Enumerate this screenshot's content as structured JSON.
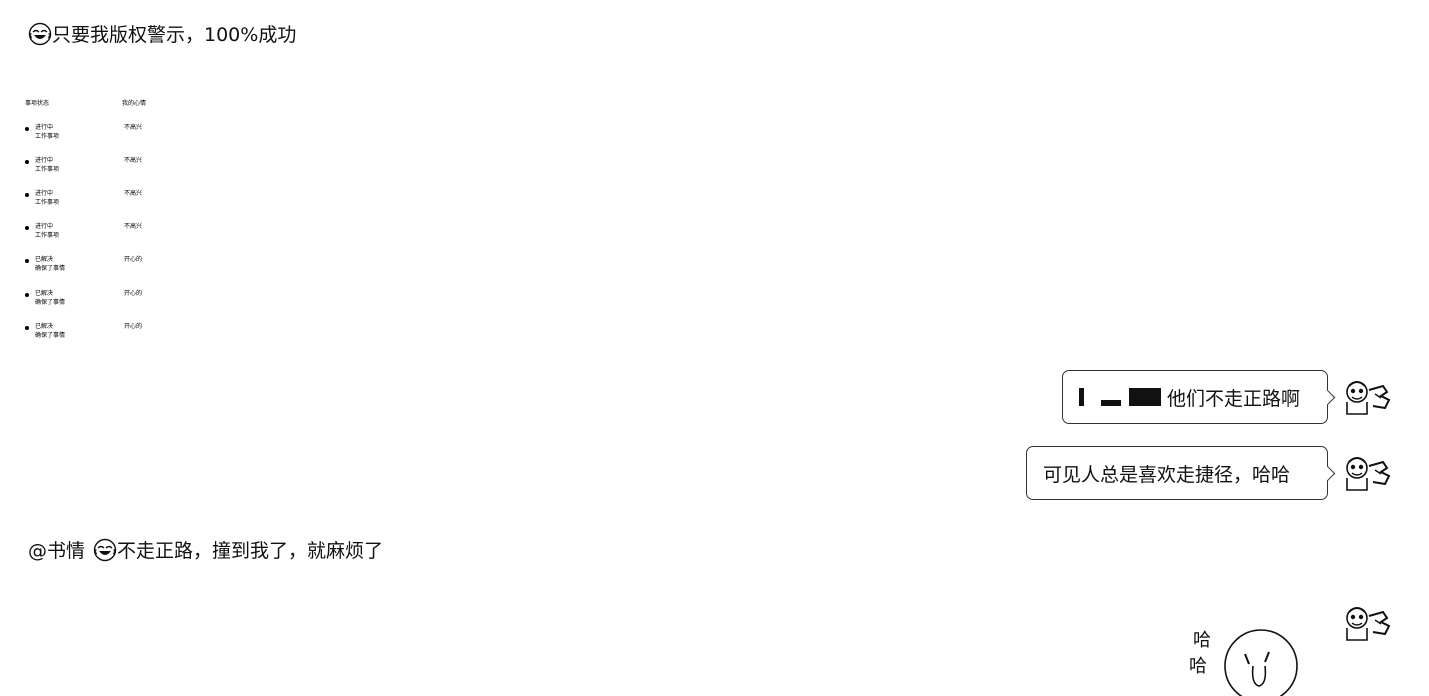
{
  "messages": {
    "top_line": {
      "emoji": "laughing-emoji",
      "text": "只要我版权警示，100%成功"
    },
    "bottom_line": {
      "mention": "@书情",
      "emoji": "laughing-emoji",
      "text": "不走正路，撞到我了，就麻烦了"
    }
  },
  "mini_table": {
    "headers": [
      "事项状态",
      "我的心情"
    ],
    "rows": [
      {
        "status": "进行中",
        "sub": "工作事项",
        "feel": "不高兴"
      },
      {
        "status": "进行中",
        "sub": "工作事项",
        "feel": "不高兴"
      },
      {
        "status": "进行中",
        "sub": "工作事项",
        "feel": "不高兴"
      },
      {
        "status": "进行中",
        "sub": "工作事项",
        "feel": "不高兴"
      },
      {
        "status": "已解决",
        "sub": "确保了事情",
        "feel": "开心的"
      },
      {
        "status": "已解决",
        "sub": "确保了事情",
        "feel": "开心的"
      },
      {
        "status": "已解决",
        "sub": "确保了事情",
        "feel": "开心的"
      }
    ]
  },
  "right_chat": {
    "bubble1_text": "他们不走正路啊",
    "bubble2_text": "可见人总是喜欢走捷径，哈哈"
  },
  "sticker": {
    "text_top": "哈",
    "text_bottom": "哈"
  }
}
